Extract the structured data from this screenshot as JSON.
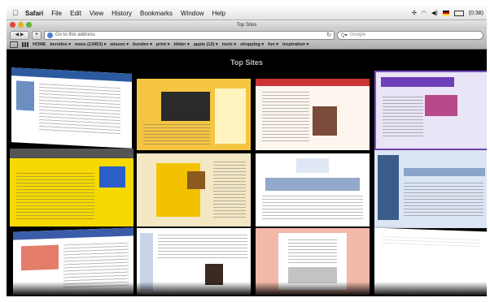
{
  "menubar": {
    "apple_icon": "apple-icon",
    "items": [
      "Safari",
      "File",
      "Edit",
      "View",
      "History",
      "Bookmarks",
      "Window",
      "Help"
    ],
    "status": {
      "clock": "(0:38)"
    }
  },
  "window": {
    "title": "Top Sites",
    "toolbar": {
      "back_label": "◀",
      "forward_label": "▶",
      "add_label": "+",
      "address_placeholder": "Go to this address",
      "reload_icon": "reload-icon",
      "search_placeholder": "Google"
    },
    "bookmarks": [
      "HOME",
      "kerstins ▾",
      "news (13453) ▾",
      "wissen ▾",
      "kunden ▾",
      "print ▾",
      "bilder ▾",
      "apple (12) ▾",
      "tools ▾",
      "shopping ▾",
      "fun ▾",
      "inspiration ▾"
    ]
  },
  "topsites": {
    "title": "Top Sites"
  },
  "colors": {
    "accent": "#4a7fd0",
    "background": "#000000"
  }
}
